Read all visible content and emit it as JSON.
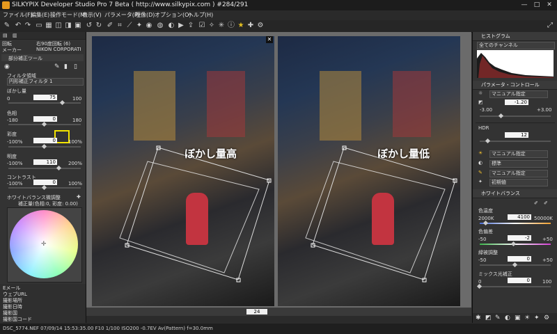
{
  "titlebar": {
    "title": "SILKYPIX Developer Studio Pro 7 Beta ( http://www.silkypix.com )  #284/291",
    "min": "—",
    "max": "□",
    "close": "✕"
  },
  "menu": [
    "ファイル(F)",
    "編集(E)",
    "操作モード(M)",
    "表示(V)",
    "パラメータ(P)",
    "現像(D)",
    "オプション(O)",
    "ヘルプ(H)"
  ],
  "left": {
    "info_rows": [
      {
        "k": "回転",
        "v": "右90度回転 (6)"
      },
      {
        "k": "メーカー",
        "v": "NIKON CORPORATI"
      }
    ],
    "tool_title": "部分補正ツール",
    "filter_region_label": "フィルタ領域",
    "filter_select": "円形補正フィルタ 1",
    "blur": {
      "label": "ぼかし量",
      "value": "75",
      "min": "0",
      "max": "100",
      "level": 0.75
    },
    "hue": {
      "label": "色相",
      "value": "0",
      "min": "-180",
      "max": "180",
      "level": 0.5
    },
    "saturation": {
      "label": "彩度",
      "value": "0",
      "min": "-100%",
      "max": "100%",
      "level": 0.5
    },
    "brightness": {
      "label": "明度",
      "value": "110",
      "min": "-100%",
      "max": "200%",
      "level": 0.7
    },
    "contrast": {
      "label": "コントラスト",
      "value": "0",
      "min": "-100%",
      "max": "100%",
      "level": 0.5
    },
    "wb_label": "ホワイトバランス微調整",
    "wb_value": "補正量(色相:0, 彩度: 0.00)",
    "meta_rows": [
      "Eメール",
      "ウェブURL",
      "撮影場所",
      "撮影日時",
      "撮影国",
      "撮影国コード"
    ]
  },
  "center": {
    "label_left": "ぼかし量高",
    "label_right": "ぼかし量低",
    "zoom": "24"
  },
  "right": {
    "histogram_title": "ヒストグラム",
    "channel_select": "全てのチャンネル",
    "param_title": "パラメータ・コントロール",
    "mode_select": "マニュアル指定",
    "exposure": {
      "value": "-1.20",
      "min": "-3.00",
      "max": "+3.00",
      "level": 0.3
    },
    "hdr": {
      "label": "HDR",
      "value": "12",
      "level": 0.12
    },
    "wb_mode": "マニュアル指定",
    "tone_select": "標準",
    "sharp_mode": "マニュアル指定",
    "default_select": "初期値",
    "wb_title": "ホワイトバランス",
    "temp": {
      "label": "色温度",
      "value": "4100",
      "min": "2000K",
      "max": "50000K",
      "level": 0.09
    },
    "tint": {
      "label": "色偏差",
      "value": "-2",
      "min": "-50",
      "max": "+50",
      "level": 0.48
    },
    "fine": {
      "label": "緑被調整",
      "value": "0",
      "min": "-50",
      "max": "+50",
      "level": 0.5
    },
    "mix": {
      "label": "ミックス光補正",
      "value": "0",
      "min": "0",
      "max": "100",
      "level": 0.0
    }
  },
  "status": "DSC_5774.NEF 07/09/14 15:53:35.00 F10 1/100 ISO200 -0.7EV Av(Pattern) f=30.0mm",
  "colors": {
    "bg": "#2b2b2b",
    "panel": "#333333",
    "highlight": "#f3e400",
    "accent": "#e69a1f"
  }
}
